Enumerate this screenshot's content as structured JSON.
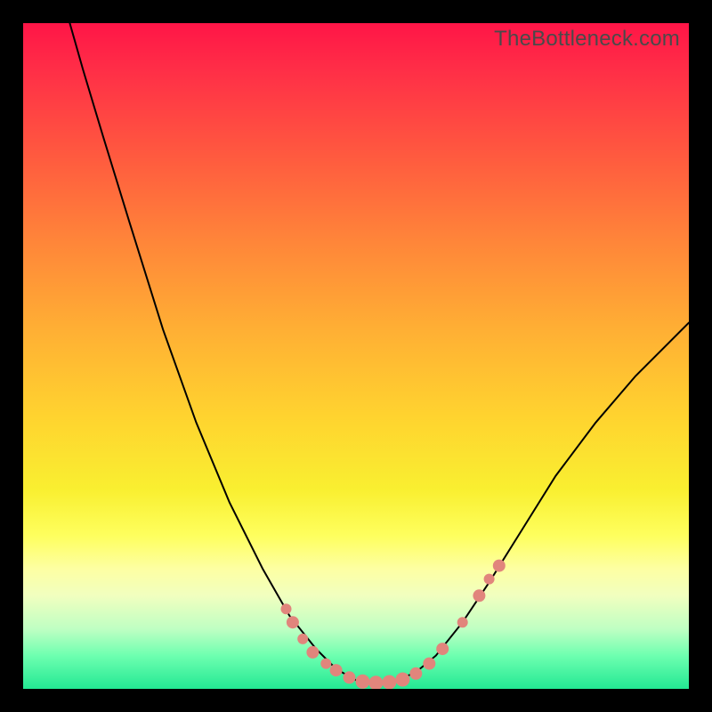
{
  "watermark": "TheBottleneck.com",
  "colors": {
    "curve_stroke": "#000000",
    "point_fill": "#e1857c",
    "gradient_top": "#ff1547",
    "gradient_bottom": "#23e893"
  },
  "chart_data": {
    "type": "line",
    "title": "",
    "xlabel": "",
    "ylabel": "",
    "xlim": [
      0,
      100
    ],
    "ylim": [
      0,
      100
    ],
    "curve": [
      {
        "x": 7,
        "y": 100
      },
      {
        "x": 9,
        "y": 93
      },
      {
        "x": 12,
        "y": 83
      },
      {
        "x": 16,
        "y": 70
      },
      {
        "x": 21,
        "y": 54
      },
      {
        "x": 26,
        "y": 40
      },
      {
        "x": 31,
        "y": 28
      },
      {
        "x": 36,
        "y": 18
      },
      {
        "x": 40,
        "y": 11
      },
      {
        "x": 44,
        "y": 6
      },
      {
        "x": 47,
        "y": 3
      },
      {
        "x": 50,
        "y": 1.3
      },
      {
        "x": 53,
        "y": 0.8
      },
      {
        "x": 56,
        "y": 1.2
      },
      {
        "x": 59,
        "y": 2.5
      },
      {
        "x": 62,
        "y": 5
      },
      {
        "x": 66,
        "y": 10
      },
      {
        "x": 70,
        "y": 16
      },
      {
        "x": 75,
        "y": 24
      },
      {
        "x": 80,
        "y": 32
      },
      {
        "x": 86,
        "y": 40
      },
      {
        "x": 92,
        "y": 47
      },
      {
        "x": 100,
        "y": 55
      }
    ],
    "points": [
      {
        "x": 39.5,
        "y": 12,
        "r": 6
      },
      {
        "x": 40.5,
        "y": 10,
        "r": 7
      },
      {
        "x": 42,
        "y": 7.5,
        "r": 6
      },
      {
        "x": 43.5,
        "y": 5.5,
        "r": 7
      },
      {
        "x": 45.5,
        "y": 3.8,
        "r": 6
      },
      {
        "x": 47,
        "y": 2.8,
        "r": 7
      },
      {
        "x": 49,
        "y": 1.7,
        "r": 7
      },
      {
        "x": 51,
        "y": 1.1,
        "r": 8
      },
      {
        "x": 53,
        "y": 0.9,
        "r": 8
      },
      {
        "x": 55,
        "y": 1.0,
        "r": 8
      },
      {
        "x": 57,
        "y": 1.4,
        "r": 8
      },
      {
        "x": 59,
        "y": 2.3,
        "r": 7
      },
      {
        "x": 61,
        "y": 3.8,
        "r": 7
      },
      {
        "x": 63,
        "y": 6.0,
        "r": 7
      },
      {
        "x": 66,
        "y": 10,
        "r": 6
      },
      {
        "x": 68.5,
        "y": 14,
        "r": 7
      },
      {
        "x": 70,
        "y": 16.5,
        "r": 6
      },
      {
        "x": 71.5,
        "y": 18.5,
        "r": 7
      }
    ]
  }
}
